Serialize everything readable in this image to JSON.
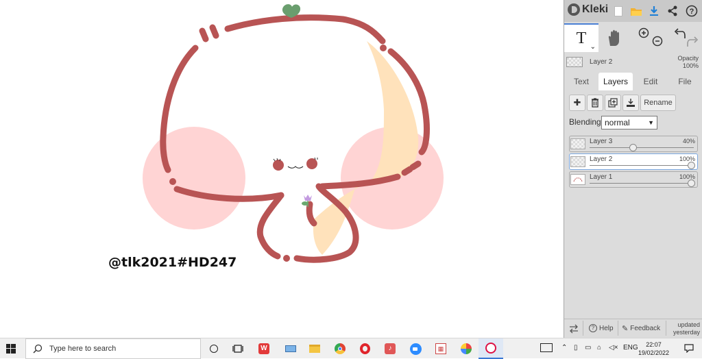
{
  "canvas": {
    "watermark": "@tlk2021#HD247",
    "colors": {
      "outline": "#b85454",
      "blush": "#ffd4d4",
      "fill": "#ffe2bb",
      "leaf": "#6a9e6e"
    }
  },
  "app": {
    "name": "Kleki"
  },
  "toolbar": {
    "icons": [
      "new-image-icon",
      "open-folder-icon",
      "download-icon",
      "share-icon",
      "help-icon"
    ]
  },
  "tools": {
    "text_tool_glyph": "T",
    "caret": "⌄"
  },
  "current_layer": {
    "name": "Layer 2",
    "opacity_label": "Opacity",
    "opacity_value": "100%"
  },
  "tabs": [
    {
      "label": "Text"
    },
    {
      "label": "Layers"
    },
    {
      "label": "Edit"
    },
    {
      "label": "File"
    }
  ],
  "layer_actions": {
    "rename_label": "Rename"
  },
  "blending": {
    "label": "Blending",
    "value": "normal"
  },
  "layers": [
    {
      "name": "Layer 3",
      "opacity": "40%",
      "opacity_fraction": 0.4
    },
    {
      "name": "Layer 2",
      "opacity": "100%",
      "opacity_fraction": 1.0
    },
    {
      "name": "Layer 1",
      "opacity": "100%",
      "opacity_fraction": 1.0
    }
  ],
  "footer": {
    "help_label": "Help",
    "feedback_label": "Feedback",
    "updated_line1": "updated",
    "updated_line2": "yesterday"
  },
  "taskbar": {
    "search_placeholder": "Type here to search",
    "language": "ENG",
    "time": "22:07",
    "date": "19/02/2022"
  }
}
